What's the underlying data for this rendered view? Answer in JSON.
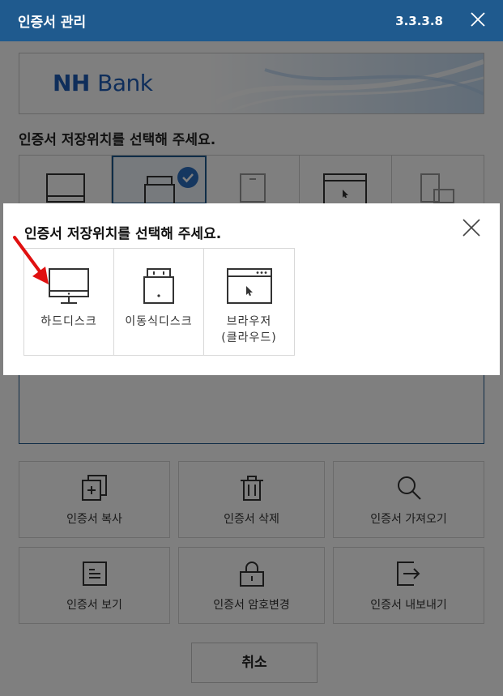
{
  "window": {
    "title": "인증서 관리",
    "version": "3.3.3.8"
  },
  "banner": {
    "logo_bold": "NH",
    "logo_light": "Bank"
  },
  "background": {
    "heading": "인증서 저장위치를 선택해 주세요."
  },
  "actions": [
    {
      "label": "인증서 복사",
      "icon": "copy-icon"
    },
    {
      "label": "인증서 삭제",
      "icon": "trash-icon"
    },
    {
      "label": "인증서 가져오기",
      "icon": "search-icon"
    },
    {
      "label": "인증서 보기",
      "icon": "document-icon"
    },
    {
      "label": "인증서 암호변경",
      "icon": "lock-icon"
    },
    {
      "label": "인증서 내보내기",
      "icon": "export-icon"
    }
  ],
  "cancel_label": "취소",
  "modal": {
    "heading": "인증서 저장위치를 선택해 주세요.",
    "options": [
      {
        "label": "하드디스크",
        "icon": "monitor-icon"
      },
      {
        "label": "이동식디스크",
        "icon": "usb-drive-icon"
      },
      {
        "label_line1": "브라우저",
        "label_line2": "(클라우드)",
        "icon": "browser-icon"
      }
    ]
  },
  "colors": {
    "titlebar": "#1f5a8e",
    "logo": "#1e5db6",
    "selection_check": "#2b6fc0",
    "annotation_arrow": "#e01010"
  }
}
